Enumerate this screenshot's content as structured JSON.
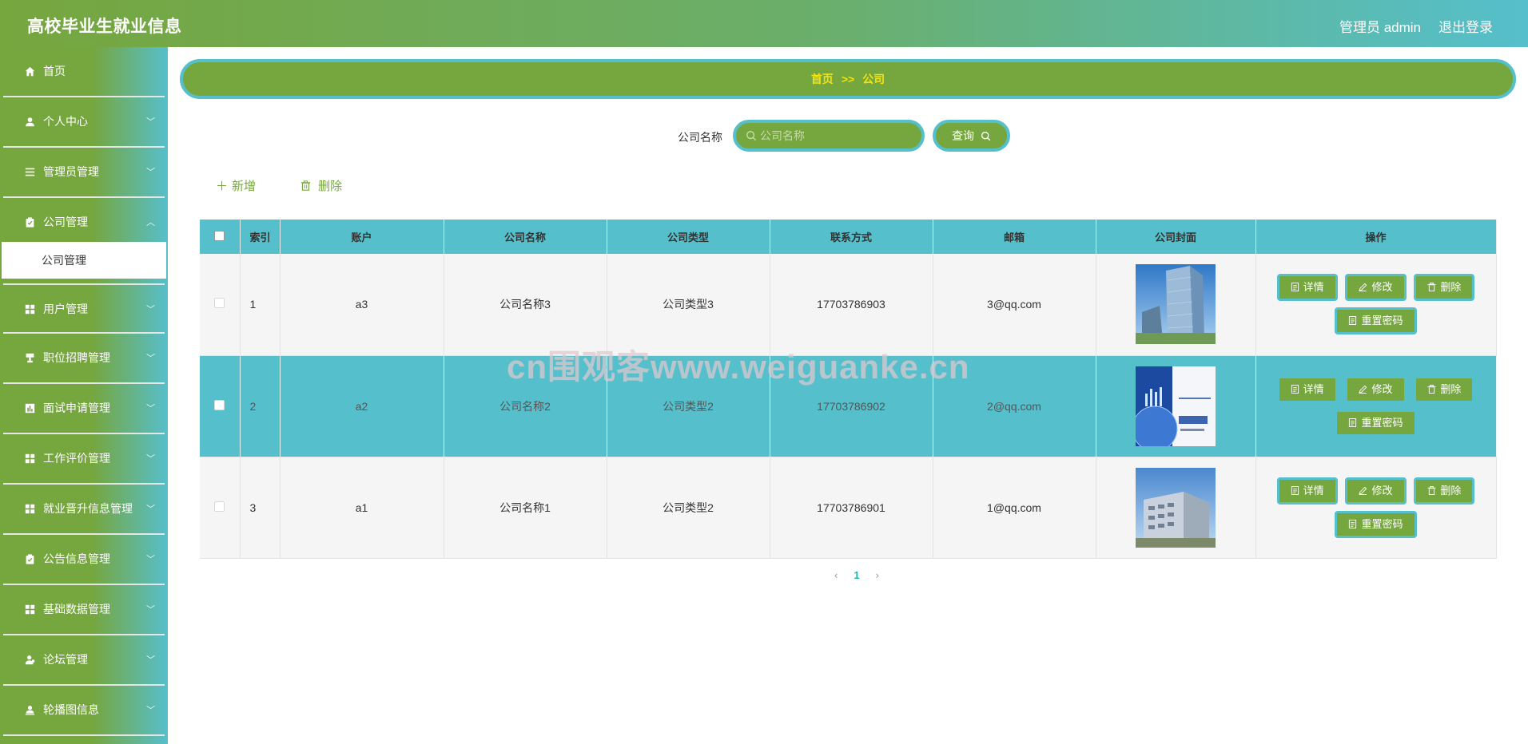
{
  "header": {
    "title": "高校毕业生就业信息",
    "user_label": "管理员 admin",
    "logout_label": "退出登录"
  },
  "sidebar": {
    "items": [
      {
        "label": "首页",
        "icon": "home-icon",
        "has_arrow": false
      },
      {
        "label": "个人中心",
        "icon": "user-icon",
        "has_arrow": true
      },
      {
        "label": "管理员管理",
        "icon": "list-icon",
        "has_arrow": true
      },
      {
        "label": "公司管理",
        "icon": "clipboard-icon",
        "has_arrow": true,
        "expanded": true
      },
      {
        "label": "用户管理",
        "icon": "grid-icon",
        "has_arrow": true
      },
      {
        "label": "职位招聘管理",
        "icon": "trophy-icon",
        "has_arrow": true
      },
      {
        "label": "面试申请管理",
        "icon": "chart-icon",
        "has_arrow": true
      },
      {
        "label": "工作评价管理",
        "icon": "grid-icon",
        "has_arrow": true
      },
      {
        "label": "就业晋升信息管理",
        "icon": "grid-icon",
        "has_arrow": true
      },
      {
        "label": "公告信息管理",
        "icon": "clipboard-icon",
        "has_arrow": true
      },
      {
        "label": "基础数据管理",
        "icon": "grid-icon",
        "has_arrow": true
      },
      {
        "label": "论坛管理",
        "icon": "user-shield-icon",
        "has_arrow": true
      },
      {
        "label": "轮播图信息",
        "icon": "user-upload-icon",
        "has_arrow": true
      }
    ],
    "submenu_active": "公司管理"
  },
  "breadcrumb": {
    "home": "首页",
    "separator": ">>",
    "current": "公司"
  },
  "search": {
    "label": "公司名称",
    "placeholder": "公司名称",
    "value": "",
    "button_label": "查询"
  },
  "actions": {
    "add_label": "新增",
    "delete_label": "删除"
  },
  "table": {
    "headers": [
      "索引",
      "账户",
      "公司名称",
      "公司类型",
      "联系方式",
      "邮箱",
      "公司封面",
      "操作"
    ],
    "rows": [
      {
        "index": "1",
        "account": "a3",
        "company_name": "公司名称3",
        "company_type": "公司类型3",
        "phone": "17703786903",
        "email": "3@qq.com",
        "cover": "glass-building-cover"
      },
      {
        "index": "2",
        "account": "a2",
        "company_name": "公司名称2",
        "company_type": "公司类型2",
        "phone": "17703786902",
        "email": "2@qq.com",
        "cover": "brochure-cover"
      },
      {
        "index": "3",
        "account": "a1",
        "company_name": "公司名称1",
        "company_type": "公司类型2",
        "phone": "17703786901",
        "email": "1@qq.com",
        "cover": "office-building-cover"
      }
    ],
    "op_labels": {
      "detail": "详情",
      "edit": "修改",
      "delete": "删除",
      "reset_password": "重置密码"
    }
  },
  "pagination": {
    "prev": "‹",
    "current": "1",
    "next": "›"
  },
  "watermark": "cn围观客www.weiguanke.cn",
  "colors": {
    "primary_green": "#76a63e",
    "accent_teal": "#56bfcc",
    "breadcrumb_text": "#f2e313"
  }
}
